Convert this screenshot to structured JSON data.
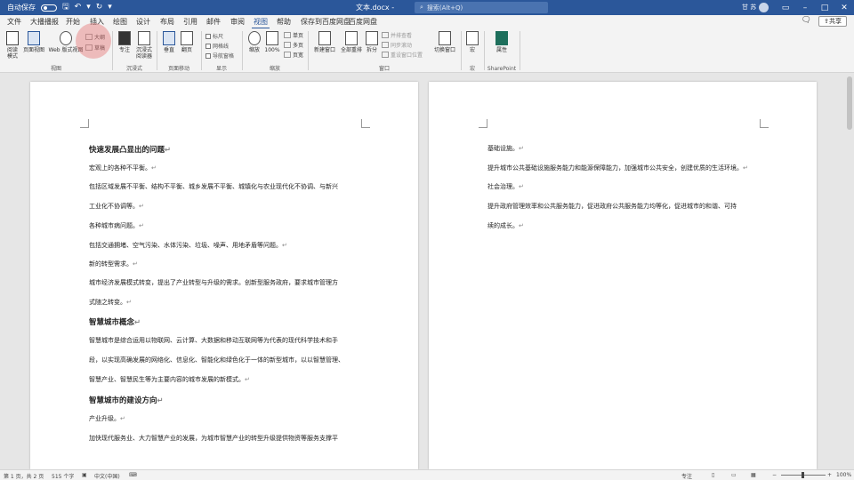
{
  "titlebar": {
    "autosave_label": "自动保存",
    "autosave_state": "关",
    "doc_title": "文本.docx  -",
    "search_placeholder": "搜索(Alt+Q)",
    "user_name": "甘 苏",
    "colors": {
      "bg": "#2b579a"
    }
  },
  "tabs": [
    {
      "label": "文件"
    },
    {
      "label": "大播播报"
    },
    {
      "label": "开始"
    },
    {
      "label": "插入"
    },
    {
      "label": "绘图"
    },
    {
      "label": "设计"
    },
    {
      "label": "布局"
    },
    {
      "label": "引用"
    },
    {
      "label": "邮件"
    },
    {
      "label": "审阅"
    },
    {
      "label": "视图"
    },
    {
      "label": "帮助"
    },
    {
      "label": "保存到百度网盘"
    },
    {
      "label": "百度网盘"
    }
  ],
  "share_label": "共享",
  "ribbon": {
    "views": {
      "read_mode": "阅读\n模式",
      "print_layout": "页面视图",
      "web_layout": "Web 版式视图",
      "outline": "大纲",
      "draft": "草稿",
      "label": "视图"
    },
    "immersive": {
      "focus": "专注",
      "reader": "沉浸式\n阅读器",
      "label": "沉浸式"
    },
    "page_move": {
      "vertical": "垂直",
      "side": "翻页",
      "label": "页面移动"
    },
    "show": {
      "ruler": "标尺",
      "gridlines": "网格线",
      "nav_pane": "导航窗格",
      "label": "显示"
    },
    "zoom": {
      "zoom": "缩放",
      "hundred": "100%",
      "one_page": "单页",
      "multi_page": "多页",
      "page_width": "页宽",
      "label": "缩放"
    },
    "window": {
      "new_window": "新建窗口",
      "arrange_all": "全部重排",
      "split": "拆分",
      "side_by_side": "并排查看",
      "sync_scroll": "同步滚动",
      "reset_pos": "重设窗口位置",
      "switch": "切换窗口",
      "label": "窗口"
    },
    "macros": {
      "macros": "宏",
      "label": "宏"
    },
    "sharepoint": {
      "properties": "属性",
      "label": "SharePoint"
    }
  },
  "page_left": {
    "paragraphs": [
      {
        "text": "快速发展凸显出的问题",
        "heading": true
      },
      {
        "text": "宏观上的各种不平衡。",
        "heading": false
      },
      {
        "text": "包括区域发展不平衡、结构不平衡、城乡发展不平衡、城镇化与农业现代化不协调、与新兴",
        "heading": false
      },
      {
        "text": "工业化不协调等。",
        "heading": false
      },
      {
        "text": "各种城市病问题。",
        "heading": false
      },
      {
        "text": "包括交通拥堵、空气污染、水体污染、垃圾、噪声、用地矛盾等问题。",
        "heading": false
      },
      {
        "text": "新的转型需求。",
        "heading": false
      },
      {
        "text": "城市经济发展模式转变，提出了产业转型与升级的需求。创新型服务政府，要求城市管理方",
        "heading": false
      },
      {
        "text": "式随之转变。",
        "heading": false
      },
      {
        "text": "智慧城市概念",
        "heading": true
      },
      {
        "text": "智慧城市是综合运用以物联网、云计算、大数据和移动互联网等为代表的现代科学技术和手",
        "heading": false
      },
      {
        "text": "段，以实现高确发展的网络化、信息化、智能化和绿色化于一体的新型城市，以以智慧管理、",
        "heading": false
      },
      {
        "text": "智慧产业、智慧民生等为主要内容的城市发展的新模式。",
        "heading": false
      },
      {
        "text": "智慧城市的建设方向",
        "heading": true
      },
      {
        "text": "产业升级。",
        "heading": false
      },
      {
        "text": "加快现代服务业、大力智慧产业的发展，为城市智慧产业的转型升级提供物资等服务支撑平",
        "heading": false
      }
    ]
  },
  "page_right": {
    "paragraphs": [
      {
        "text": "基础设施。"
      },
      {
        "text": "提升城市公共基础设施服务能力和能源保障能力，加强城市公共安全，创建优质的生活环境。"
      },
      {
        "text": "社会治理。"
      },
      {
        "text": "提升政府管理效率和公共服务能力，促进政府公共服务能力均等化，促进城市的和谐、可持"
      },
      {
        "text": "续的成长。"
      }
    ]
  },
  "statusbar": {
    "page": "第 1 页，共 2 页",
    "words": "515 个字",
    "language": "中文(中国)",
    "accessibility": "",
    "focus": "专注",
    "zoom": "100%"
  },
  "paragraph_mark": "↵"
}
